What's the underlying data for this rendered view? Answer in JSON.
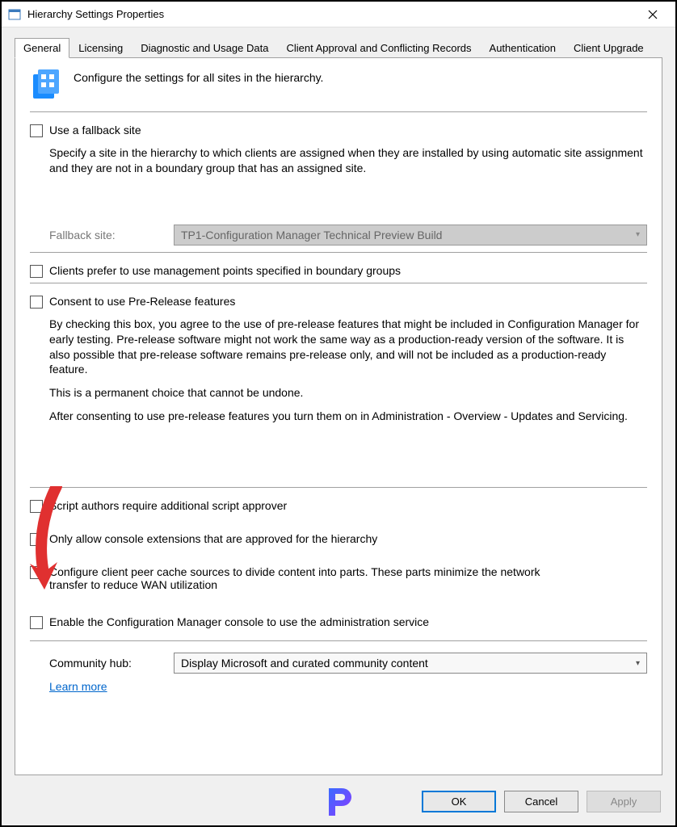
{
  "window": {
    "title": "Hierarchy Settings Properties"
  },
  "tabs": {
    "items": [
      {
        "label": "General"
      },
      {
        "label": "Licensing"
      },
      {
        "label": "Diagnostic and Usage Data"
      },
      {
        "label": "Client Approval and Conflicting Records"
      },
      {
        "label": "Authentication"
      },
      {
        "label": "Client Upgrade"
      }
    ],
    "active": 0
  },
  "general": {
    "intro": "Configure the settings for all sites in the hierarchy.",
    "fallback": {
      "checkbox_label": "Use a fallback site",
      "description": "Specify a site in the hierarchy to which clients are assigned when they are installed by using automatic site assignment and they are not in a boundary group that has an assigned site.",
      "label": "Fallback site:",
      "selected": "TP1-Configuration Manager Technical Preview Build"
    },
    "mgmt_points_label": "Clients prefer to use management points specified in boundary groups",
    "prerelease": {
      "checkbox_label": "Consent to use Pre-Release features",
      "p1": "By checking this box, you agree to the use of pre-release features that might be included in Configuration Manager for early testing. Pre-release software might not work the same way as a production-ready version of the software. It is also possible that pre-release software remains pre-release only, and will not be included as a production-ready feature.",
      "p2": "This is a permanent choice that cannot be undone.",
      "p3": "After consenting to use pre-release features you turn them on in Administration - Overview - Updates and Servicing."
    },
    "script_approver_label": "Script authors require additional script approver",
    "console_ext_label": "Only allow console extensions that are approved for the hierarchy",
    "peer_cache_label": "Configure client peer cache sources to divide content into parts. These parts minimize the network transfer to reduce WAN utilization",
    "admin_service_label": "Enable the Configuration Manager console to use the administration service",
    "community": {
      "label": "Community hub:",
      "selected": "Display Microsoft and curated community content",
      "learn_more": "Learn more"
    }
  },
  "buttons": {
    "ok": "OK",
    "cancel": "Cancel",
    "apply": "Apply"
  }
}
